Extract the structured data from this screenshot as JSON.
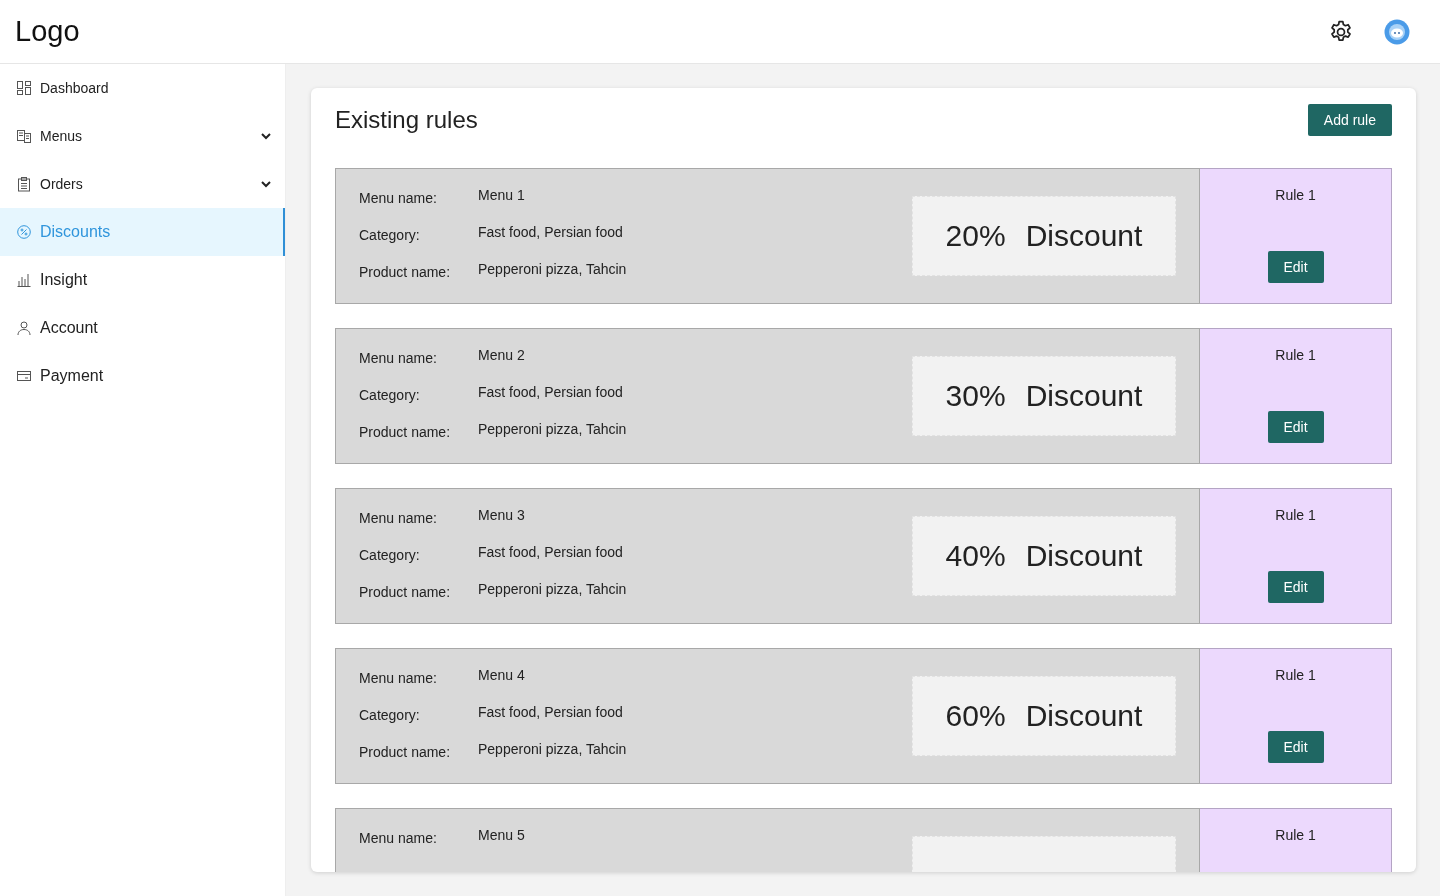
{
  "header": {
    "logo": "Logo"
  },
  "sidebar": {
    "items": [
      {
        "label": "Dashboard",
        "kind": "link",
        "selected": false
      },
      {
        "label": "Menus",
        "kind": "dropdown",
        "selected": false
      },
      {
        "label": "Orders",
        "kind": "dropdown",
        "selected": false
      },
      {
        "label": "Discounts",
        "kind": "link",
        "selected": true
      },
      {
        "label": "Insight",
        "kind": "link",
        "selected": false
      },
      {
        "label": "Account",
        "kind": "link",
        "selected": false
      },
      {
        "label": "Payment",
        "kind": "link",
        "selected": false
      }
    ]
  },
  "panel": {
    "title": "Existing rules",
    "add_button": "Add rule",
    "rules": [
      {
        "fields": [
          {
            "label": "Menu name:",
            "value": "Menu 1"
          },
          {
            "label": "Category:",
            "value": "Fast food, Persian food"
          },
          {
            "label": "Product name:",
            "value": "Pepperoni pizza, Tahcin"
          }
        ],
        "percent": "20%",
        "discount": "Discount",
        "rule": "Rule 1",
        "button": "Edit"
      },
      {
        "fields": [
          {
            "label": "Menu name:",
            "value": "Menu 2"
          },
          {
            "label": "Category:",
            "value": "Fast food, Persian food"
          },
          {
            "label": "Product name:",
            "value": "Pepperoni pizza, Tahcin"
          }
        ],
        "percent": "30%",
        "discount": "Discount",
        "rule": "Rule 1",
        "button": "Edit"
      },
      {
        "fields": [
          {
            "label": "Menu name:",
            "value": "Menu 3"
          },
          {
            "label": "Category:",
            "value": "Fast food, Persian food"
          },
          {
            "label": "Product name:",
            "value": "Pepperoni pizza, Tahcin"
          }
        ],
        "percent": "40%",
        "discount": "Discount",
        "rule": "Rule 1",
        "button": "Edit"
      },
      {
        "fields": [
          {
            "label": "Menu name:",
            "value": "Menu 4"
          },
          {
            "label": "Category:",
            "value": "Fast food, Persian food"
          },
          {
            "label": "Product name:",
            "value": "Pepperoni pizza, Tahcin"
          }
        ],
        "percent": "60%",
        "discount": "Discount",
        "rule": "Rule 1",
        "button": "Edit"
      },
      {
        "fields": [
          {
            "label": "Menu name:",
            "value": "Menu 5"
          }
        ],
        "rule": "Rule 1"
      }
    ]
  }
}
